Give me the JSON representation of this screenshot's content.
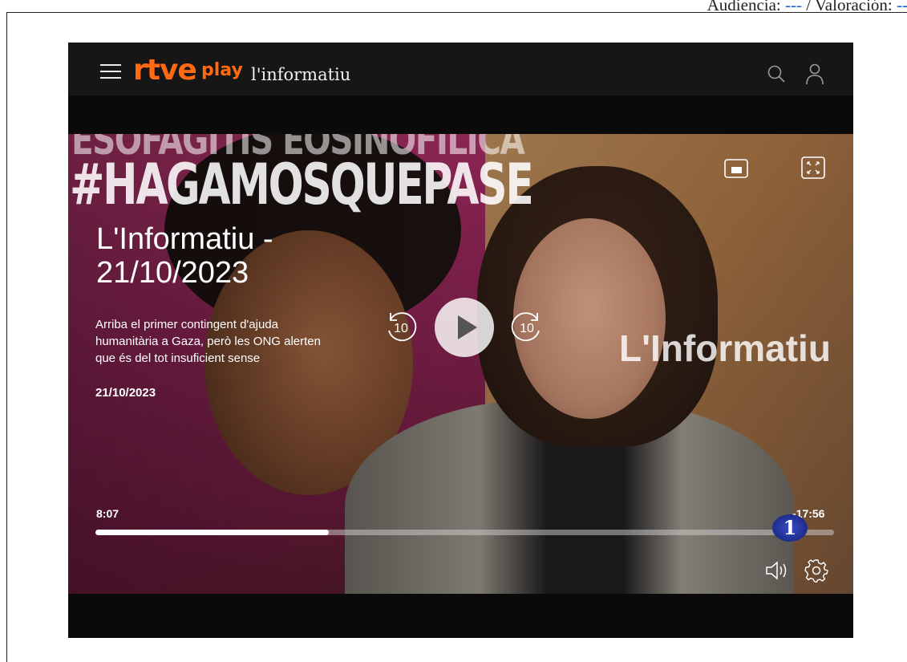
{
  "header_text": {
    "prefix": "Audiencia: ",
    "audience_value": "---",
    "separator": " / Valoración: ",
    "rating_value": "---"
  },
  "topbar": {
    "brand_main": "rtve",
    "brand_sub": "play",
    "program": "l'informatiu",
    "brand_color": "#ff6a13",
    "icons": [
      "menu-icon",
      "search-icon",
      "user-icon"
    ]
  },
  "video": {
    "overlay_banner_line1": "ESOFAGITIS EOSINOFÍLICA",
    "overlay_banner_line2": "#HAGAMOSQUEPASE",
    "watermark": "L'Informatiu",
    "episode_title": "L'Informatiu - 21/10/2023",
    "episode_description": "Arriba el primer contingent d'ajuda humanitària a Gaza, però les ONG alerten que és del tot insuficient sense",
    "episode_date": "21/10/2023",
    "rewind_seconds": "10",
    "forward_seconds": "10",
    "channel_badge": "1"
  },
  "playback": {
    "current_time": "8:07",
    "remaining_time": "-17:56",
    "progress_fraction": 0.316
  }
}
